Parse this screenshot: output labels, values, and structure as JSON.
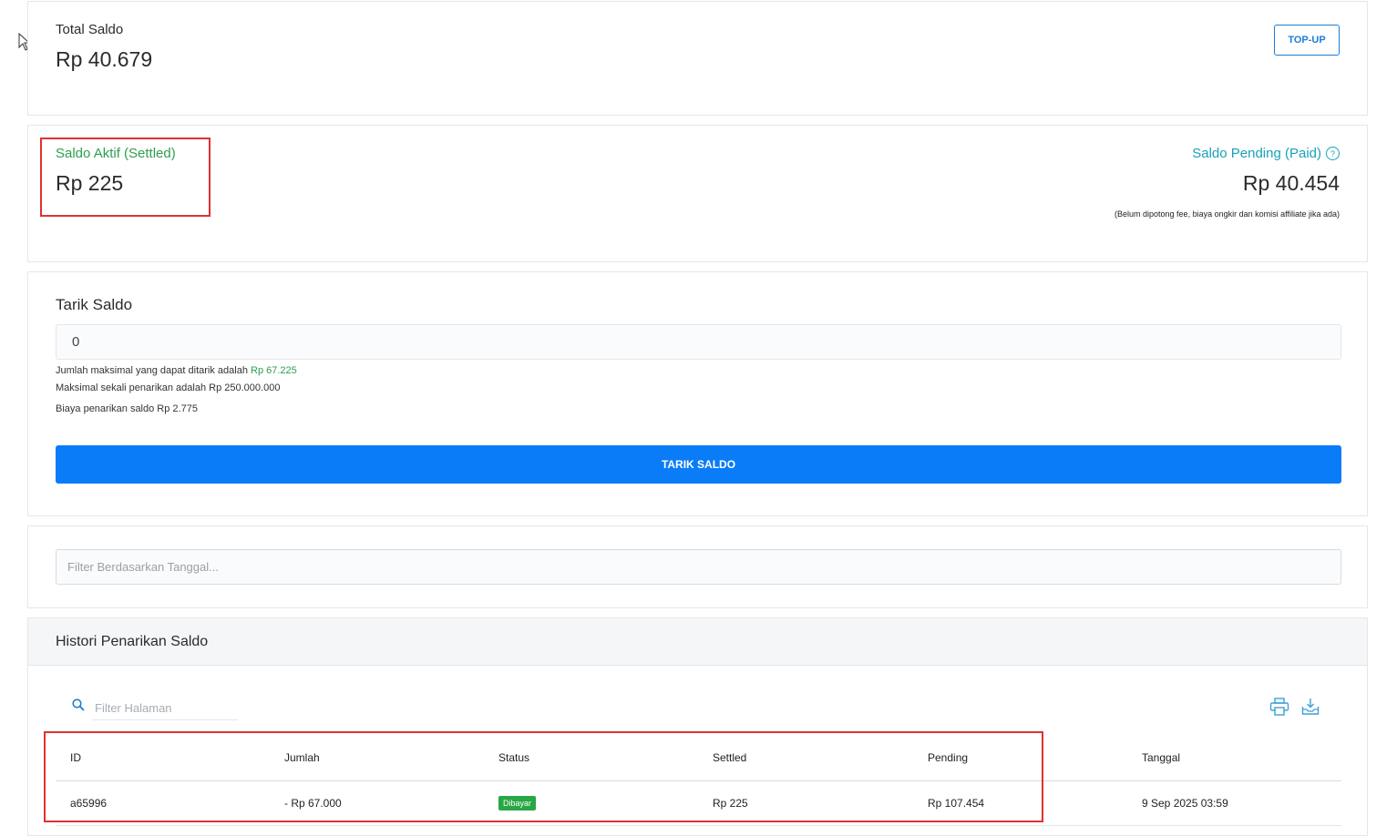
{
  "total": {
    "label": "Total Saldo",
    "amount": "Rp 40.679",
    "topup_label": "TOP-UP"
  },
  "saldo": {
    "aktif_label": "Saldo Aktif (Settled)",
    "aktif_amount": "Rp 225",
    "pending_label": "Saldo Pending (Paid)",
    "pending_amount": "Rp 40.454",
    "pending_note": "(Belum dipotong fee, biaya ongkir dan komisi affiliate jika ada)"
  },
  "tarik": {
    "label": "Tarik Saldo",
    "input_value": "0",
    "max_prefix": "Jumlah maksimal yang dapat ditarik adalah",
    "max_amount": "Rp 67.225",
    "max_once": "Maksimal sekali penarikan adalah Rp 250.000.000",
    "fee": "Biaya penarikan saldo Rp 2.775",
    "button_label": "TARIK SALDO"
  },
  "filter": {
    "placeholder": "Filter Berdasarkan Tanggal..."
  },
  "histori": {
    "title": "Histori Penarikan Saldo",
    "search_placeholder": "Filter Halaman",
    "columns": [
      "ID",
      "Jumlah",
      "Status",
      "Settled",
      "Pending",
      "Tanggal"
    ],
    "rows": [
      {
        "id": "a65996",
        "jumlah": "- Rp 67.000",
        "status": "Dibayar",
        "settled": "Rp 225",
        "pending": "Rp 107.454",
        "tanggal": "9 Sep 2025 03:59"
      }
    ]
  },
  "colors": {
    "primary": "#0a7cf8",
    "success": "#2e9e4c",
    "info": "#17a2b8",
    "highlight": "#e03131"
  }
}
